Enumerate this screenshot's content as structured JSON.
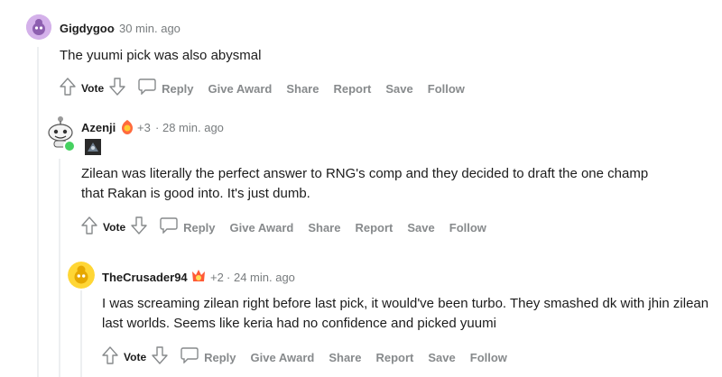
{
  "comments": [
    {
      "username": "Gigdygoo",
      "time": "30 min. ago",
      "body": "The yuumi pick was also abysmal",
      "actions": {
        "vote": "Vote",
        "reply": "Reply",
        "give_award": "Give Award",
        "share": "Share",
        "report": "Report",
        "save": "Save",
        "follow": "Follow"
      }
    },
    {
      "username": "Azenji",
      "score_badge": "+3",
      "time": "28 min. ago",
      "body": "Zilean was literally the perfect answer to RNG's comp and they decided to draft the one champ that Rakan is good into. It's just dumb.",
      "actions": {
        "vote": "Vote",
        "reply": "Reply",
        "give_award": "Give Award",
        "share": "Share",
        "report": "Report",
        "save": "Save",
        "follow": "Follow"
      }
    },
    {
      "username": "TheCrusader94",
      "score_badge": "+2",
      "time": "24 min. ago",
      "body": "I was screaming zilean right before last pick, it would've been turbo. They smashed dk with jhin zilean last worlds. Seems like keria had no confidence and picked yuumi",
      "actions": {
        "vote": "Vote",
        "reply": "Reply",
        "give_award": "Give Award",
        "share": "Share",
        "report": "Report",
        "save": "Save",
        "follow": "Follow"
      }
    }
  ],
  "colors": {
    "online": "#46d160",
    "meta": "#787c7e",
    "action": "#878a8c",
    "thread_line": "#edeff1"
  },
  "separator": "·"
}
